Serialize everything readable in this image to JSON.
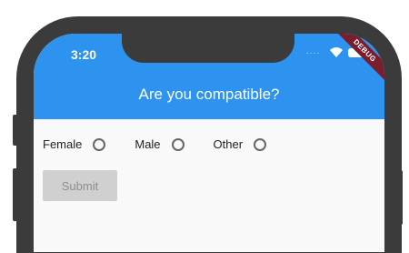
{
  "status_bar": {
    "time": "3:20",
    "signal_dots": "....",
    "debug_label": "DEBUG"
  },
  "appbar": {
    "title": "Are you compatible?"
  },
  "form": {
    "options": [
      {
        "label": "Female"
      },
      {
        "label": "Male"
      },
      {
        "label": "Other"
      }
    ],
    "submit_label": "Submit"
  },
  "colors": {
    "appbar": "#2e93ee",
    "frame": "#3b3b3b",
    "debug_banner": "#7a1d2c"
  },
  "icons": [
    "wifi-icon",
    "battery-icon"
  ]
}
